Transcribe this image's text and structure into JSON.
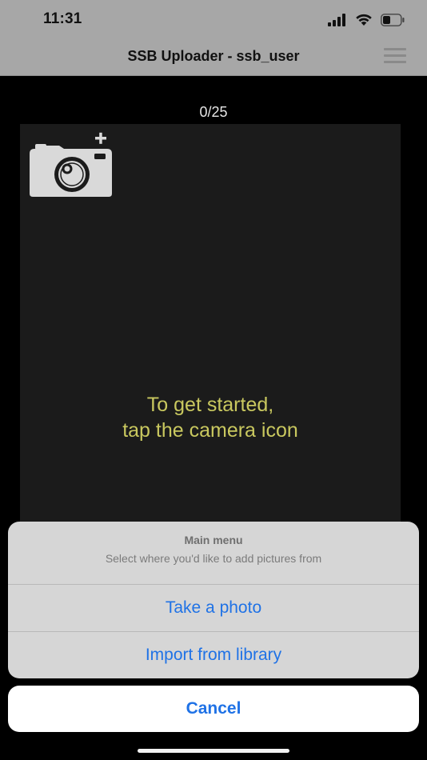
{
  "status_bar": {
    "time": "11:31",
    "icons": [
      "cellular-signal-icon",
      "wifi-icon",
      "battery-icon"
    ]
  },
  "header": {
    "title": "SSB Uploader - ssb_user",
    "menu_icon": "hamburger-menu-icon"
  },
  "main": {
    "counter": "0/25",
    "camera_icon": "camera-add-icon",
    "hint_line1": "To get started,",
    "hint_line2": "tap the camera icon"
  },
  "action_sheet": {
    "title": "Main menu",
    "message": "Select where you'd like to add pictures from",
    "actions": [
      {
        "label": "Take a photo"
      },
      {
        "label": "Import from library"
      }
    ],
    "cancel_label": "Cancel"
  },
  "colors": {
    "header_bg": "#a7a7a7",
    "photo_area_bg": "#1b1b1b",
    "hint_text": "#c9c85f",
    "action_blue": "#1f72e6",
    "sheet_bg": "#d6d6d6"
  }
}
